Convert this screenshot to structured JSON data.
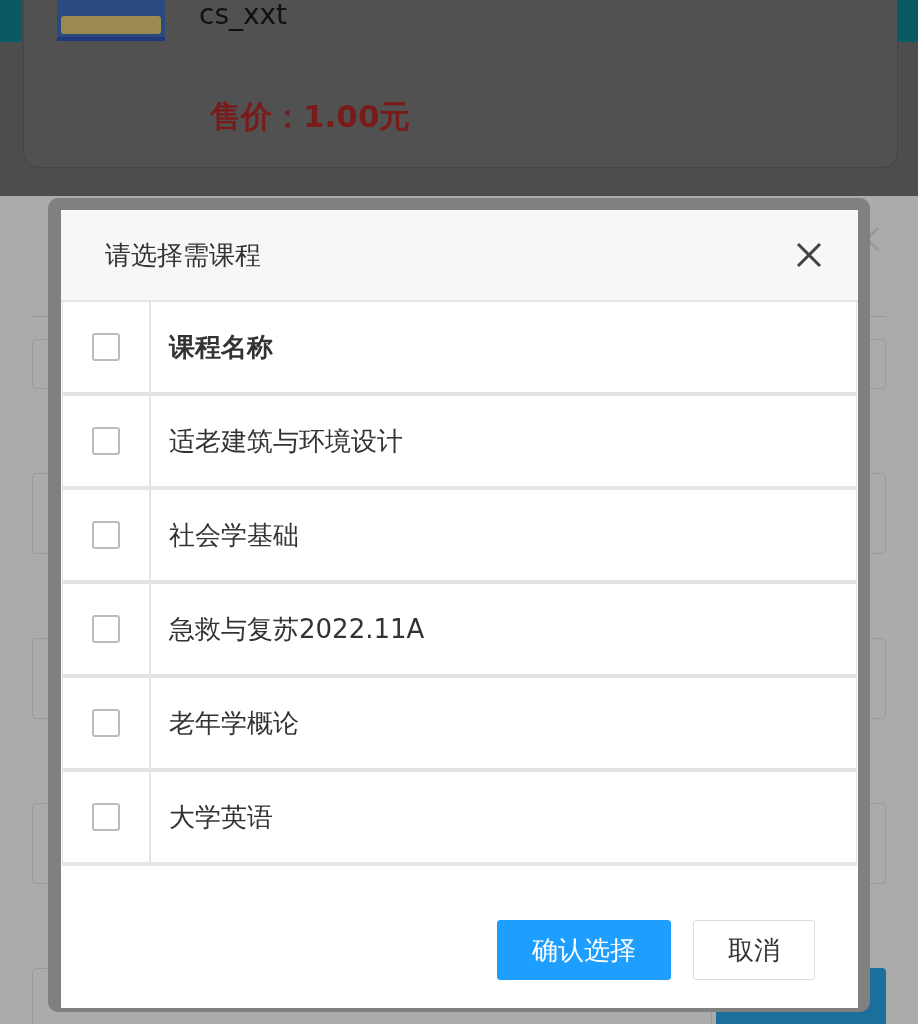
{
  "product": {
    "name": "cs_xxt",
    "price": "售价：1.00元"
  },
  "dialog": {
    "title": "请选择需课程",
    "header": {
      "label": "课程名称",
      "checked": false
    },
    "rows": [
      {
        "name": "适老建筑与环境设计",
        "checked": false
      },
      {
        "name": "社会学基础",
        "checked": false
      },
      {
        "name": "急救与复苏2022.11A",
        "checked": false
      },
      {
        "name": "老年学概论",
        "checked": false
      },
      {
        "name": "大学英语",
        "checked": false
      }
    ],
    "buttons": [
      {
        "label": "确认选择",
        "kind": "primary"
      },
      {
        "label": "取消",
        "kind": "default"
      }
    ]
  }
}
